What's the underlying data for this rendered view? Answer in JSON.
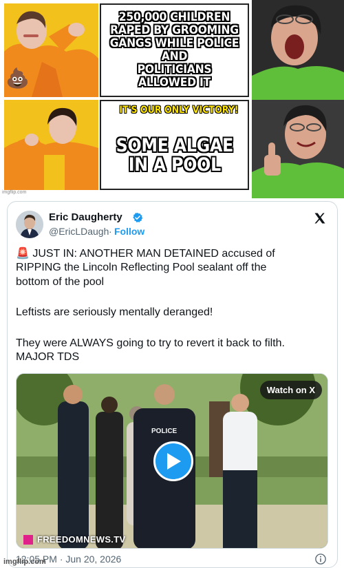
{
  "meme": {
    "top_caption": [
      "250,000 CHILDREN",
      "RAPED BY GROOMING",
      "GANGS WHILE POLICE AND",
      "POLITICIANS ALLOWED IT"
    ],
    "exclaim": "IT'S OUR ONLY VICTORY!",
    "bottom_caption": [
      "SOME ALGAE",
      "IN A POOL"
    ],
    "emoji": "💩",
    "watermark": "imgflip.com"
  },
  "tweet": {
    "author_name": "Eric Daugherty",
    "handle": "@EricLDaugh",
    "separator": "·",
    "follow_label": "Follow",
    "lines": [
      "🚨 JUST IN: ANOTHER MAN DETAINED accused of",
      "RIPPING the Lincoln Reflecting Pool sealant off the",
      "bottom of the pool",
      "Leftists are seriously mentally deranged!",
      "They were ALWAYS going to try to revert it back to filth.",
      "MAJOR TDS"
    ],
    "media": {
      "watch_label": "Watch on X",
      "police_label": "POLICE",
      "watermark": "FREEDOMNEWS.TV"
    },
    "timestamp": "12:05 PM · Jun 20, 2026"
  },
  "footer": {
    "watermark": "imgflip.com"
  },
  "colors": {
    "accent": "#1d9bf0",
    "drake_orange": "#f08a1c",
    "drake_bg": "#f2c11c",
    "hoodie_green": "#5fbf3a"
  }
}
